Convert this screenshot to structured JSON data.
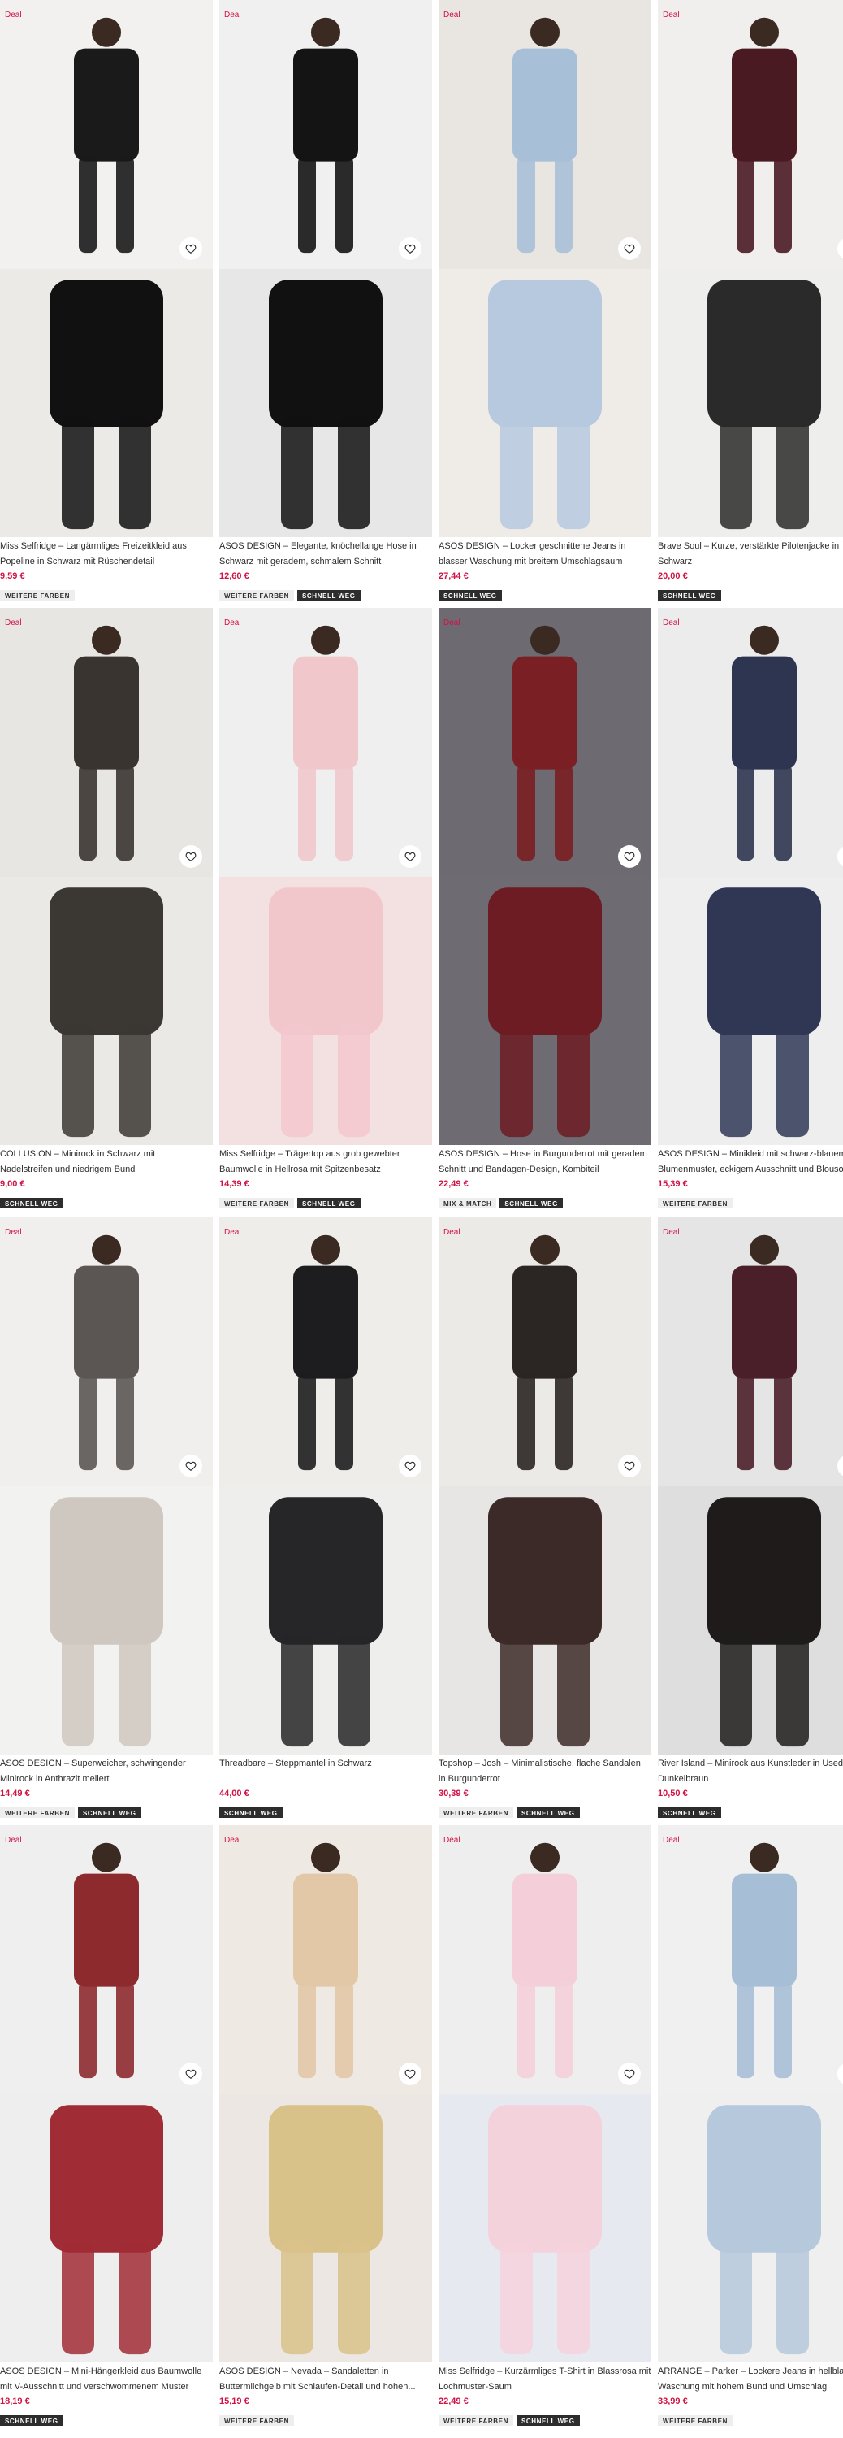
{
  "products": [
    {
      "deal": "Deal",
      "title_l1": "Miss Selfridge – Langärmliges Freizeitkleid aus",
      "title_l2": "Popeline in Schwarz mit Rüschendetail",
      "price": "9,59 €",
      "badges": [
        "WEITERE FARBEN"
      ]
    },
    {
      "deal": "Deal",
      "title_l1": "ASOS DESIGN – Elegante, knöchellange Hose in",
      "title_l2": "Schwarz mit geradem, schmalem Schnitt",
      "price": "12,60 €",
      "badges": [
        "WEITERE FARBEN",
        "SCHNELL WEG"
      ]
    },
    {
      "deal": "Deal",
      "title_l1": "ASOS DESIGN – Locker geschnittene Jeans in",
      "title_l2": "blasser Waschung mit breitem Umschlagsaum",
      "price": "27,44 €",
      "badges": [
        "SCHNELL WEG"
      ]
    },
    {
      "deal": "Deal",
      "title_l1": "Brave Soul – Kurze, verstärkte Pilotenjacke in",
      "title_l2": "Schwarz",
      "price": "20,00 €",
      "badges": [
        "SCHNELL WEG"
      ]
    },
    {
      "deal": "Deal",
      "title_l1": "COLLUSION – Minirock in Schwarz mit",
      "title_l2": "Nadelstreifen und niedrigem Bund",
      "price": "9,00 €",
      "badges": [
        "SCHNELL WEG"
      ]
    },
    {
      "deal": "Deal",
      "title_l1": "Miss Selfridge – Trägertop aus grob gewebter",
      "title_l2": "Baumwolle in Hellrosa mit Spitzenbesatz",
      "price": "14,39 €",
      "badges": [
        "WEITERE FARBEN",
        "SCHNELL WEG"
      ]
    },
    {
      "deal": "Deal",
      "title_l1": "ASOS DESIGN – Hose in Burgunderrot mit geradem",
      "title_l2": "Schnitt und Bandagen-Design, Kombiteil",
      "price": "22,49 €",
      "badges": [
        "MIX & MATCH",
        "SCHNELL WEG"
      ]
    },
    {
      "deal": "Deal",
      "title_l1": "ASOS DESIGN – Minikleid mit schwarz-blauem",
      "title_l2": "Blumenmuster, eckigem Ausschnitt und Blouson",
      "price": "15,39 €",
      "badges": [
        "WEITERE FARBEN"
      ]
    },
    {
      "deal": "Deal",
      "title_l1": "ASOS DESIGN – Superweicher, schwingender",
      "title_l2": "Minirock in Anthrazit meliert",
      "price": "14,49 €",
      "badges": [
        "WEITERE FARBEN",
        "SCHNELL WEG"
      ]
    },
    {
      "deal": "Deal",
      "title_l1": "Threadbare – Steppmantel in Schwarz",
      "title_l2": "",
      "price": "44,00 €",
      "badges": [
        "SCHNELL WEG"
      ]
    },
    {
      "deal": "Deal",
      "title_l1": "Topshop – Josh – Minimalistische, flache Sandalen",
      "title_l2": "in Burgunderrot",
      "price": "30,39 €",
      "badges": [
        "WEITERE FARBEN",
        "SCHNELL WEG"
      ]
    },
    {
      "deal": "Deal",
      "title_l1": "River Island – Minirock aus Kunstleder in Used-",
      "title_l2": "Dunkelbraun",
      "price": "10,50 €",
      "badges": [
        "SCHNELL WEG"
      ]
    },
    {
      "deal": "Deal",
      "title_l1": "ASOS DESIGN – Mini-Hängerkleid aus Baumwolle",
      "title_l2": "mit V-Ausschnitt und verschwommenem Muster",
      "price": "18,19 €",
      "badges": [
        "SCHNELL WEG"
      ]
    },
    {
      "deal": "Deal",
      "title_l1": "ASOS DESIGN – Nevada – Sandaletten in",
      "title_l2": "Buttermilchgelb mit Schlaufen-Detail und hohen...",
      "price": "15,19 €",
      "badges": [
        "WEITERE FARBEN"
      ]
    },
    {
      "deal": "Deal",
      "title_l1": "Miss Selfridge – Kurzärmliges T-Shirt in Blassrosa mit",
      "title_l2": "Lochmuster-Saum",
      "price": "22,49 €",
      "badges": [
        "WEITERE FARBEN",
        "SCHNELL WEG"
      ]
    },
    {
      "deal": "Deal",
      "title_l1": "ARRANGE – Parker – Lockere Jeans in hellblauer",
      "title_l2": "Waschung mit hohem Bund und Umschlag",
      "price": "33,99 €",
      "badges": [
        "WEITERE FARBEN"
      ]
    }
  ],
  "colors": {
    "deal_red": "#d01345",
    "price_red": "#d01345",
    "badge_dark": "#2d2d2d",
    "badge_light": "#eeeeee"
  },
  "icons": {
    "wishlist": "heart-icon"
  }
}
